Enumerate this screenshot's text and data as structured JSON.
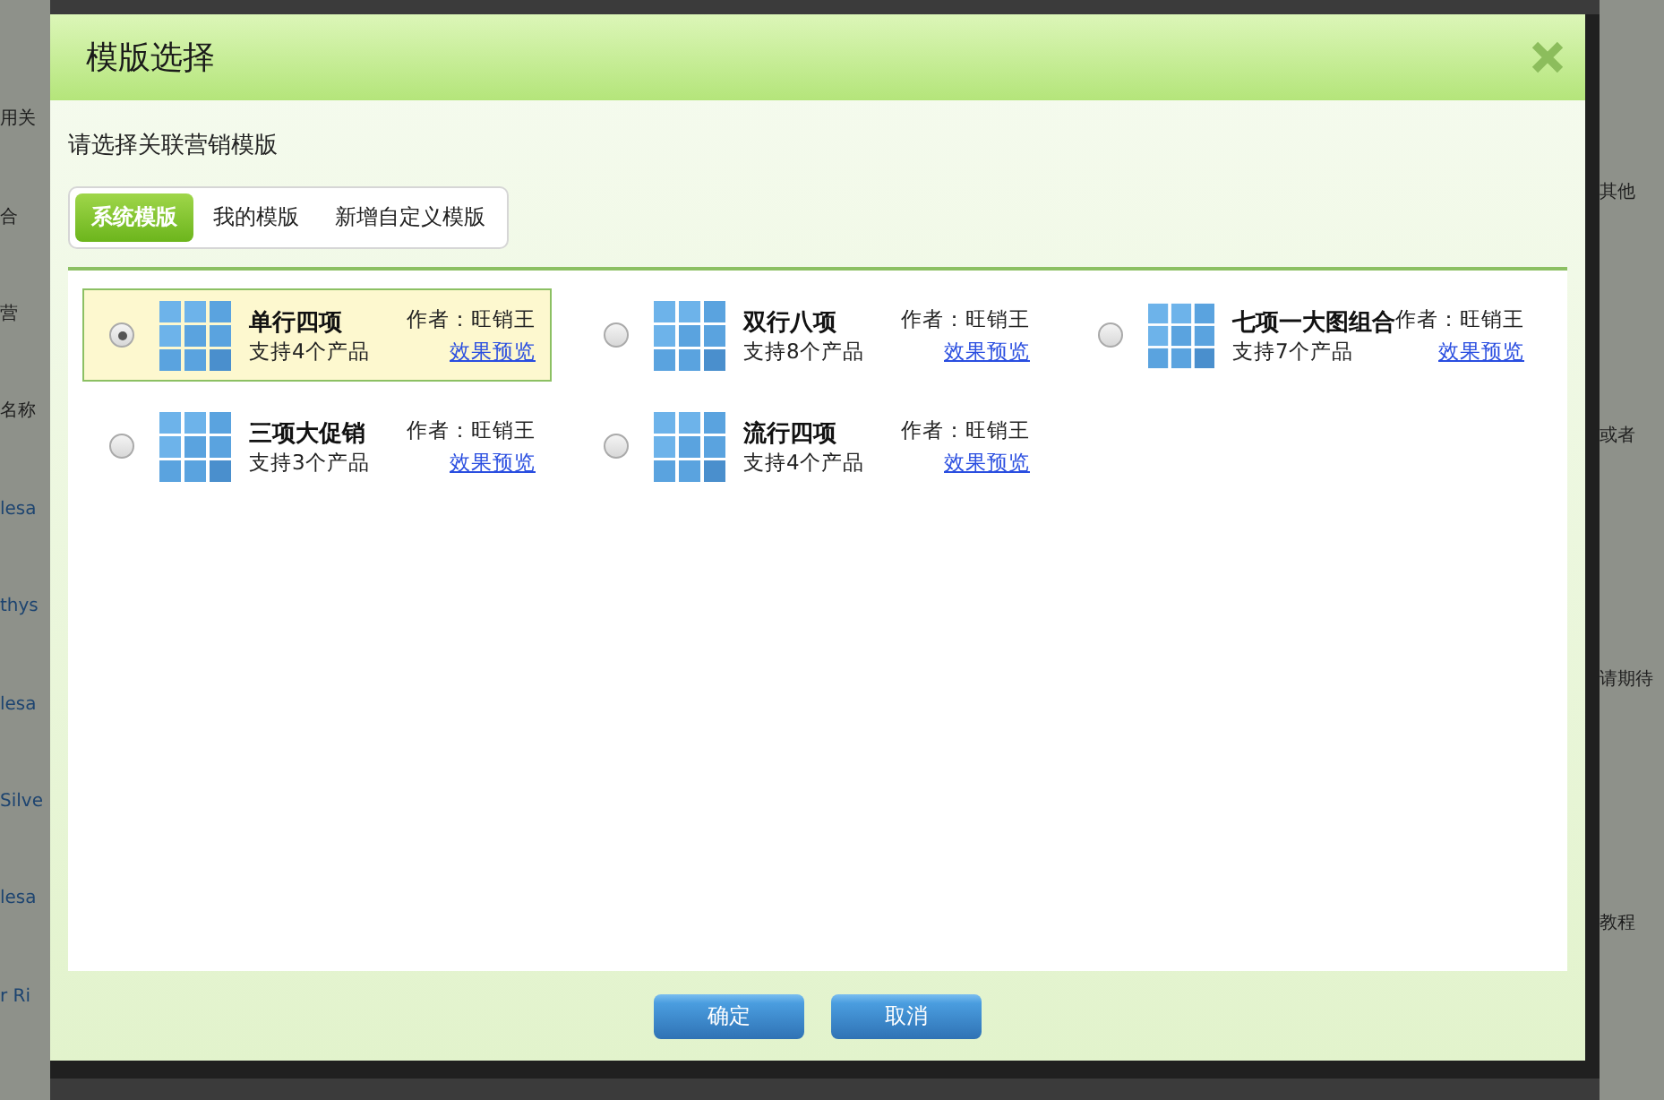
{
  "background": {
    "left_fragments": [
      {
        "text": "用关",
        "kind": "text"
      },
      {
        "text": "合",
        "kind": "text"
      },
      {
        "text": "营",
        "kind": "text"
      },
      {
        "text": "名称",
        "kind": "text"
      },
      {
        "text": "lesa",
        "kind": "link"
      },
      {
        "text": "thys",
        "kind": "link"
      },
      {
        "text": "lesa",
        "kind": "link"
      },
      {
        "text": "Silve",
        "kind": "link"
      },
      {
        "text": "lesa",
        "kind": "link"
      },
      {
        "text": "r Ri",
        "kind": "link"
      }
    ],
    "right_fragments": [
      "其他",
      "或者",
      "请期待",
      "教程"
    ]
  },
  "dialog": {
    "title": "模版选择",
    "prompt": "请选择关联营销模版",
    "tabs": [
      {
        "label": "系统模版",
        "selected": true
      },
      {
        "label": "我的模版",
        "selected": false
      },
      {
        "label": "新增自定义模版",
        "selected": false
      }
    ],
    "templates": [
      {
        "name": "单行四项",
        "support": "支持4个产品",
        "author": "作者：旺销王",
        "preview": "效果预览",
        "selected": true
      },
      {
        "name": "双行八项",
        "support": "支持8个产品",
        "author": "作者：旺销王",
        "preview": "效果预览",
        "selected": false
      },
      {
        "name": "七项一大图组合",
        "support": "支持7个产品",
        "author": "作者：旺销王",
        "preview": "效果预览",
        "selected": false
      },
      {
        "name": "三项大促销",
        "support": "支持3个产品",
        "author": "作者：旺销王",
        "preview": "效果预览",
        "selected": false
      },
      {
        "name": "流行四项",
        "support": "支持4个产品",
        "author": "作者：旺销王",
        "preview": "效果预览",
        "selected": false
      }
    ],
    "buttons": [
      "确定",
      "取消"
    ]
  }
}
